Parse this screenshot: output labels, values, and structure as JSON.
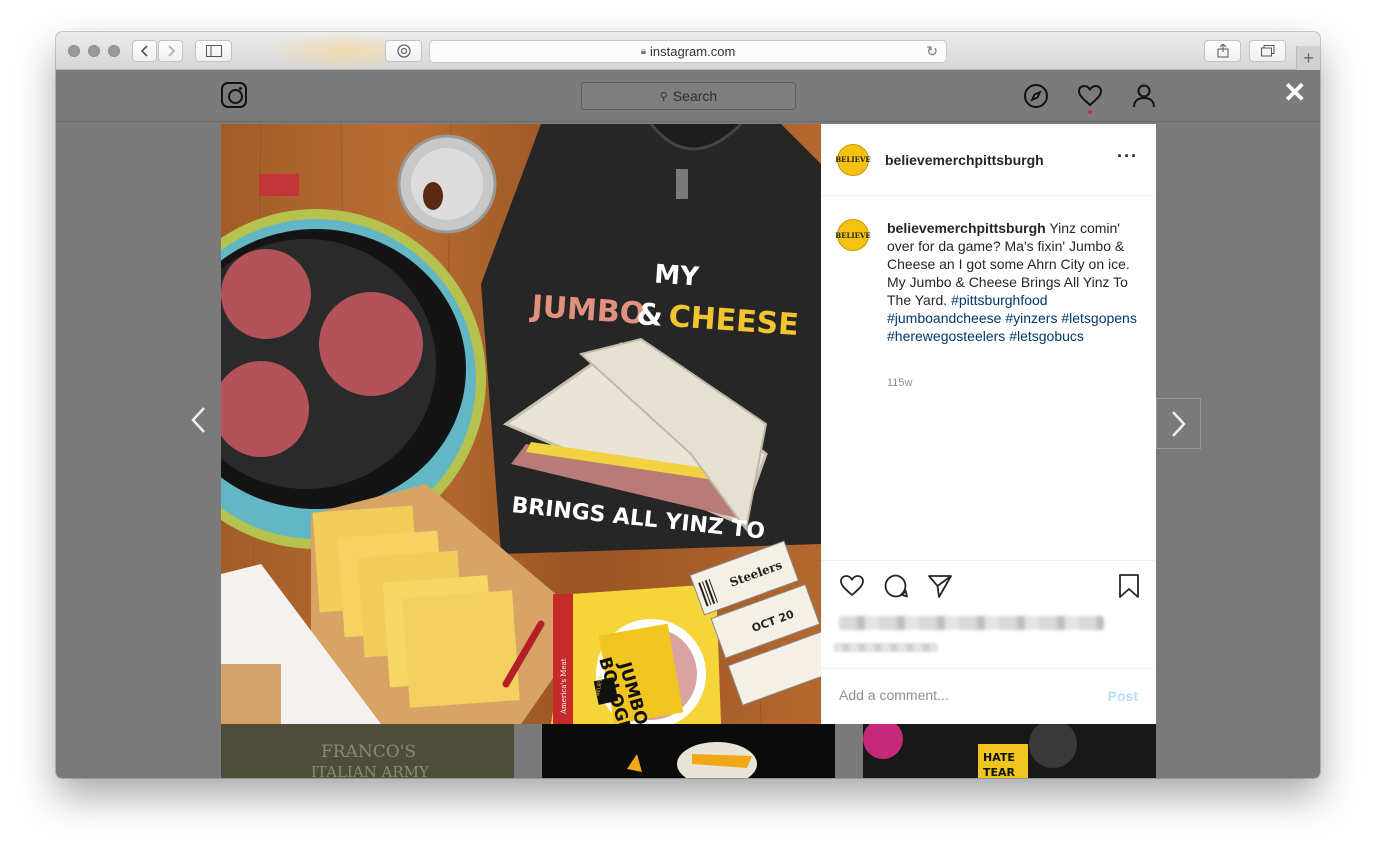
{
  "browser": {
    "url": "instagram.com",
    "new_tab_symbol": "+"
  },
  "nav": {
    "search_placeholder": "Search",
    "close_symbol": "✕"
  },
  "post": {
    "username": "believemerchpittsburgh",
    "avatar_text": "BELIEVE",
    "more_symbol": "···",
    "caption_text": "Yinz comin' over for da game? Ma's fixin' Jumbo & Cheese an I got some Ahrn City on ice. My Jumbo & Cheese Brings All Yinz To The Yard.",
    "hashtags": [
      "#pittsburghfood",
      "#jumboandcheese",
      "#yinzers",
      "#letsgopens",
      "#herewegosteelers",
      "#letsgobucs"
    ],
    "time_ago": "115w",
    "comment_placeholder": "Add a comment...",
    "post_button": "Post"
  },
  "photo": {
    "shirt_line1": "MY",
    "shirt_line2a": "JUMBO",
    "shirt_line2b": "&",
    "shirt_line2c": "CHEESE",
    "shirt_line3": "BRINGS ALL YINZ TO",
    "pack_line1": "JUMBO",
    "pack_line2": "BOLOGNA",
    "pack_brand": "BELIEVE",
    "pack_side": "America's Meat",
    "ticket_text": "Steelers",
    "ticket_date": "OCT 20"
  },
  "thumbs": {
    "thumb1_text1": "FRANCO'S",
    "thumb1_text2": "ITALIAN ARMY",
    "thumb3_text1": "HATE",
    "thumb3_text2": "TEAR"
  },
  "colors": {
    "accent_link": "#00376b",
    "avatar_yellow": "#f5c211",
    "post_button": "#b2dffc",
    "notification_dot": "#c0392b"
  }
}
